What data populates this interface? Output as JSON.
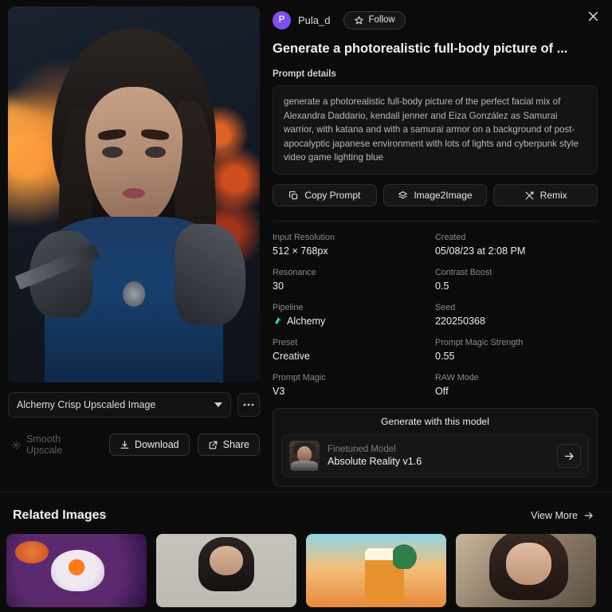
{
  "author": {
    "avatar_initial": "P",
    "name": "Pula_d",
    "follow_label": "Follow",
    "follow_icon": "star-icon",
    "avatar_color": "#7d4ef0"
  },
  "close_icon": "close-icon",
  "generation": {
    "title": "Generate a photorealistic full-body picture of ...",
    "prompt_details_label": "Prompt details",
    "prompt_text": "generate a photorealistic full-body picture of the perfect facial mix of Alexandra Daddario, kendall jenner and Eiza González as Samurai warrior, with katana and with a samurai armor on a background of post-apocalyptic japanese environment with lots of lights and cyberpunk style video game lighting blue"
  },
  "prompt_actions": [
    {
      "label": "Copy Prompt",
      "icon": "copy-icon"
    },
    {
      "label": "Image2Image",
      "icon": "layers-icon"
    },
    {
      "label": "Remix",
      "icon": "remix-icon"
    }
  ],
  "metadata": [
    {
      "key": "Input Resolution",
      "value": "512 × 768px"
    },
    {
      "key": "Created",
      "value": "05/08/23 at 2:08 PM"
    },
    {
      "key": "Resonance",
      "value": "30"
    },
    {
      "key": "Contrast Boost",
      "value": "0.5"
    },
    {
      "key": "Pipeline",
      "value": "Alchemy",
      "icon": "flask-icon",
      "icon_color": "#3ddc84"
    },
    {
      "key": "Seed",
      "value": "220250368"
    },
    {
      "key": "Preset",
      "value": "Creative"
    },
    {
      "key": "Prompt Magic Strength",
      "value": "0.55"
    },
    {
      "key": "Prompt Magic",
      "value": "V3"
    },
    {
      "key": "RAW Mode",
      "value": "Off"
    }
  ],
  "model_card": {
    "title": "Generate with this model",
    "subtitle": "Finetuned Model",
    "name": "Absolute Reality v1.6",
    "arrow_icon": "arrow-right-icon",
    "thumbnail": "model-thumbnail"
  },
  "image_tools": {
    "variant_select": "Alchemy Crisp Upscaled Image",
    "more_options_icon": "ellipsis-icon",
    "smooth_upscale_label": "Smooth Upscale",
    "smooth_upscale_icon": "sparkle-icon",
    "download_label": "Download",
    "download_icon": "download-icon",
    "share_label": "Share",
    "share_icon": "share-icon"
  },
  "related": {
    "title": "Related Images",
    "view_more_label": "View More",
    "view_more_icon": "arrow-right-icon",
    "thumbnails": [
      {
        "name": "astronaut-space-art"
      },
      {
        "name": "woman-black-dress-portrait"
      },
      {
        "name": "beer-beach-illustration"
      },
      {
        "name": "woman-closeup-portrait"
      }
    ]
  }
}
